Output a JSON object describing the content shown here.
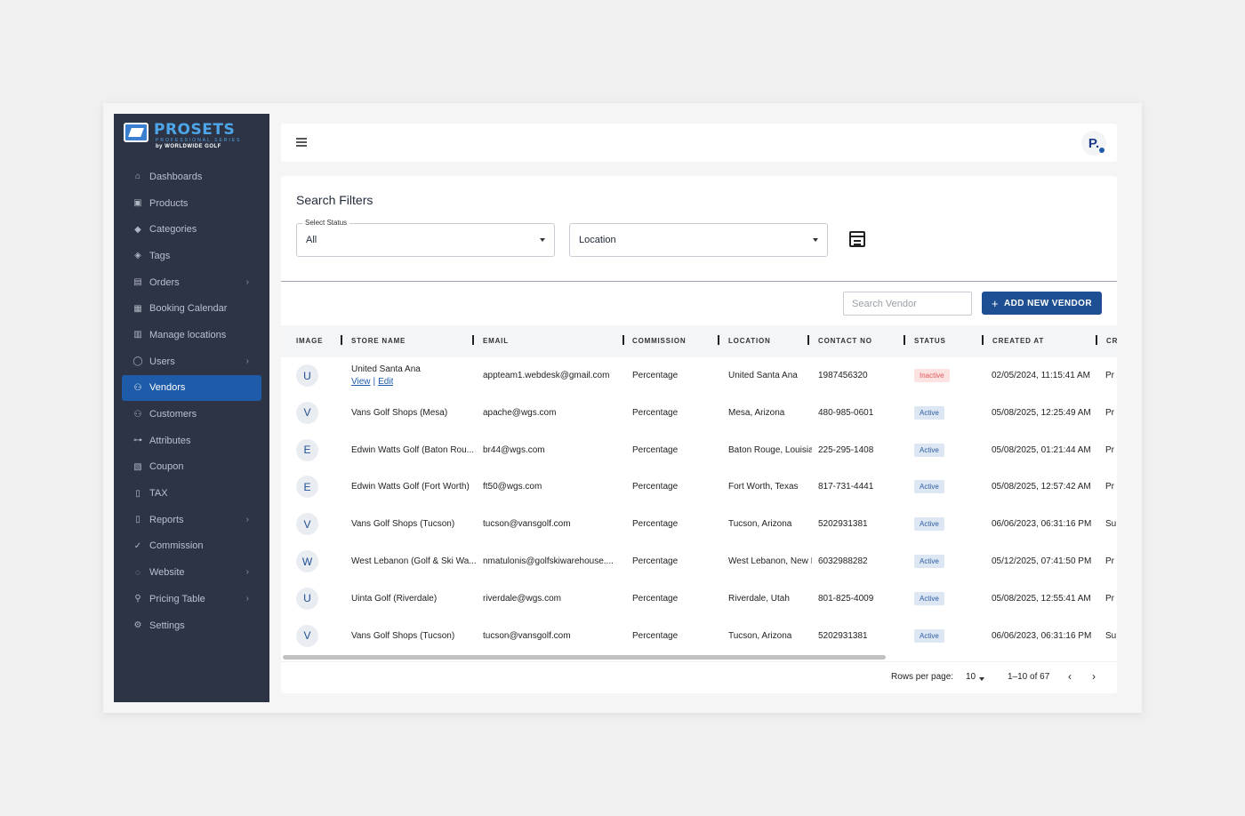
{
  "brand": {
    "title": "PROSETS",
    "subtitle": "PROFESSIONAL SERIES",
    "by": "by WORLDWIDE GOLF"
  },
  "sidebar": {
    "items": [
      {
        "label": "Dashboards",
        "icon": "home-icon",
        "chevron": false
      },
      {
        "label": "Products",
        "icon": "box-icon",
        "chevron": false
      },
      {
        "label": "Categories",
        "icon": "shapes-icon",
        "chevron": false
      },
      {
        "label": "Tags",
        "icon": "tag-icon",
        "chevron": false
      },
      {
        "label": "Orders",
        "icon": "clipboard-icon",
        "chevron": true
      },
      {
        "label": "Booking Calendar",
        "icon": "calendar-icon",
        "chevron": false
      },
      {
        "label": "Manage locations",
        "icon": "map-pin-icon",
        "chevron": false
      },
      {
        "label": "Users",
        "icon": "user-icon",
        "chevron": true
      },
      {
        "label": "Vendors",
        "icon": "store-icon",
        "chevron": false,
        "active": true
      },
      {
        "label": "Customers",
        "icon": "users-icon",
        "chevron": false
      },
      {
        "label": "Attributes",
        "icon": "hierarchy-icon",
        "chevron": false
      },
      {
        "label": "Coupon",
        "icon": "ticket-icon",
        "chevron": false
      },
      {
        "label": "TAX",
        "icon": "document-icon",
        "chevron": false
      },
      {
        "label": "Reports",
        "icon": "report-icon",
        "chevron": true
      },
      {
        "label": "Commission",
        "icon": "badge-check-icon",
        "chevron": false
      },
      {
        "label": "Website",
        "icon": "globe-icon",
        "chevron": true
      },
      {
        "label": "Pricing Table",
        "icon": "price-tag-icon",
        "chevron": true
      },
      {
        "label": "Settings",
        "icon": "gear-icon",
        "chevron": false
      }
    ]
  },
  "topbar": {
    "avatar_letter": "P."
  },
  "filters": {
    "title": "Search Filters",
    "status_legend": "Select Status",
    "status_value": "All",
    "location_value": "Location"
  },
  "toolbar": {
    "search_placeholder": "Search Vendor",
    "add_label": "ADD NEW VENDOR"
  },
  "table": {
    "columns": [
      "IMAGE",
      "STORE NAME",
      "EMAIL",
      "COMMISSION",
      "LOCATION",
      "CONTACT NO",
      "STATUS",
      "CREATED AT",
      "CR"
    ],
    "rows": [
      {
        "initial": "U",
        "store": "United Santa Ana",
        "email": "appteam1.webdesk@gmail.com",
        "commission": "Percentage",
        "location": "United Santa Ana",
        "contact": "1987456320",
        "status": "Inactive",
        "created": "02/05/2024, 11:15:41 AM",
        "extra": "Pr",
        "view": "View",
        "edit": "Edit",
        "sep": "|"
      },
      {
        "initial": "V",
        "store": "Vans Golf Shops (Mesa)",
        "email": "apache@wgs.com",
        "commission": "Percentage",
        "location": "Mesa, Arizona",
        "contact": "480-985-0601",
        "status": "Active",
        "created": "05/08/2025, 12:25:49 AM",
        "extra": "Pr"
      },
      {
        "initial": "E",
        "store": "Edwin Watts Golf (Baton Rou...",
        "email": "br44@wgs.com",
        "commission": "Percentage",
        "location": "Baton Rouge, Louisia",
        "contact": "225-295-1408",
        "status": "Active",
        "created": "05/08/2025, 01:21:44 AM",
        "extra": "Pr"
      },
      {
        "initial": "E",
        "store": "Edwin Watts Golf (Fort Worth)",
        "email": "ft50@wgs.com",
        "commission": "Percentage",
        "location": "Fort Worth, Texas",
        "contact": "817-731-4441",
        "status": "Active",
        "created": "05/08/2025, 12:57:42 AM",
        "extra": "Pr"
      },
      {
        "initial": "V",
        "store": "Vans Golf Shops (Tucson)",
        "email": "tucson@vansgolf.com",
        "commission": "Percentage",
        "location": "Tucson, Arizona",
        "contact": "5202931381",
        "status": "Active",
        "created": "06/06/2023, 06:31:16 PM",
        "extra": "Su"
      },
      {
        "initial": "W",
        "store": "West Lebanon (Golf & Ski Wa...",
        "email": "nmatulonis@golfskiwarehouse....",
        "commission": "Percentage",
        "location": "West Lebanon, New I",
        "contact": "6032988282",
        "status": "Active",
        "created": "05/12/2025, 07:41:50 PM",
        "extra": "Pr"
      },
      {
        "initial": "U",
        "store": "Uinta Golf (Riverdale)",
        "email": "riverdale@wgs.com",
        "commission": "Percentage",
        "location": "Riverdale, Utah",
        "contact": "801-825-4009",
        "status": "Active",
        "created": "05/08/2025, 12:55:41 AM",
        "extra": "Pr"
      },
      {
        "initial": "V",
        "store": "Vans Golf Shops (Tucson)",
        "email": "tucson@vansgolf.com",
        "commission": "Percentage",
        "location": "Tucson, Arizona",
        "contact": "5202931381",
        "status": "Active",
        "created": "06/06/2023, 06:31:16 PM",
        "extra": "Su"
      }
    ]
  },
  "pagination": {
    "rows_label": "Rows per page:",
    "rows_value": "10",
    "range": "1–10 of 67"
  },
  "colors": {
    "sidebar_bg": "#2d3446",
    "accent": "#1e4f92",
    "active_nav": "#1e5ba8"
  }
}
